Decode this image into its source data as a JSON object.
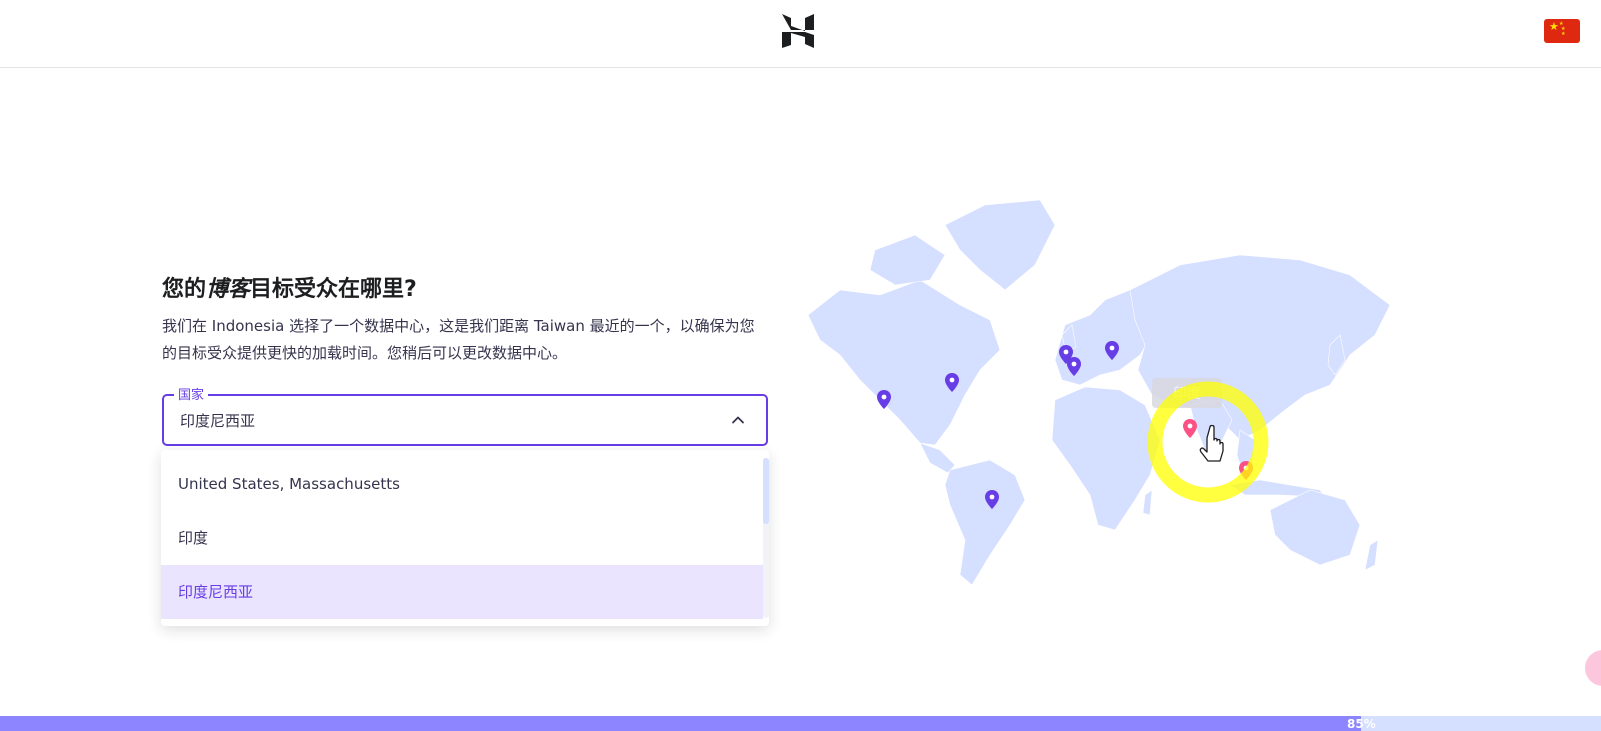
{
  "header": {
    "logo_icon": "hostinger-logo",
    "flag_icon": "china-flag"
  },
  "main": {
    "title_prefix": "您的",
    "title_italic": "博客",
    "title_suffix": "目标受众在哪里?",
    "description": "我们在 Indonesia 选择了一个数据中心，这是我们距离 Taiwan 最近的一个，以确保为您的目标受众提供更快的加载时间。您稍后可以更改数据中心。",
    "country_field": {
      "label": "国家",
      "value": "印度尼西亚"
    },
    "dropdown_options": [
      "United States, Massachusetts",
      "印度",
      "印度尼西亚"
    ],
    "selected_option": "印度尼西亚"
  },
  "map": {
    "tooltip": "印度"
  },
  "progress": {
    "percent": 85,
    "label": "85%"
  },
  "colors": {
    "accent": "#673de6",
    "map_land": "#d5dfff",
    "pin": "#673de6",
    "pin_active": "#fc5185",
    "progress_fill": "#8c85ff",
    "highlight_ring": "#ffff00"
  }
}
